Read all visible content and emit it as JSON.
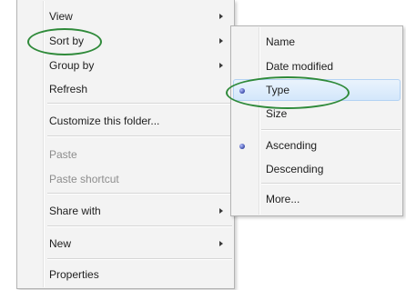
{
  "context_menu": {
    "items": [
      {
        "label": "View",
        "submenu": true
      },
      {
        "label": "Sort by",
        "submenu": true
      },
      {
        "label": "Group by",
        "submenu": true
      },
      {
        "label": "Refresh"
      },
      {
        "label": "Customize this folder..."
      },
      {
        "label": "Paste",
        "disabled": true
      },
      {
        "label": "Paste shortcut",
        "disabled": true
      },
      {
        "label": "Share with",
        "submenu": true
      },
      {
        "label": "New",
        "submenu": true
      },
      {
        "label": "Properties"
      }
    ]
  },
  "sort_submenu": {
    "items": [
      {
        "label": "Name"
      },
      {
        "label": "Date modified"
      },
      {
        "label": "Type",
        "selected": true
      },
      {
        "label": "Size"
      },
      {
        "label": "Ascending",
        "selected": true
      },
      {
        "label": "Descending"
      },
      {
        "label": "More..."
      }
    ]
  },
  "annotation_color": "#2f8a3a",
  "highlight_color": "#d4e7fb"
}
